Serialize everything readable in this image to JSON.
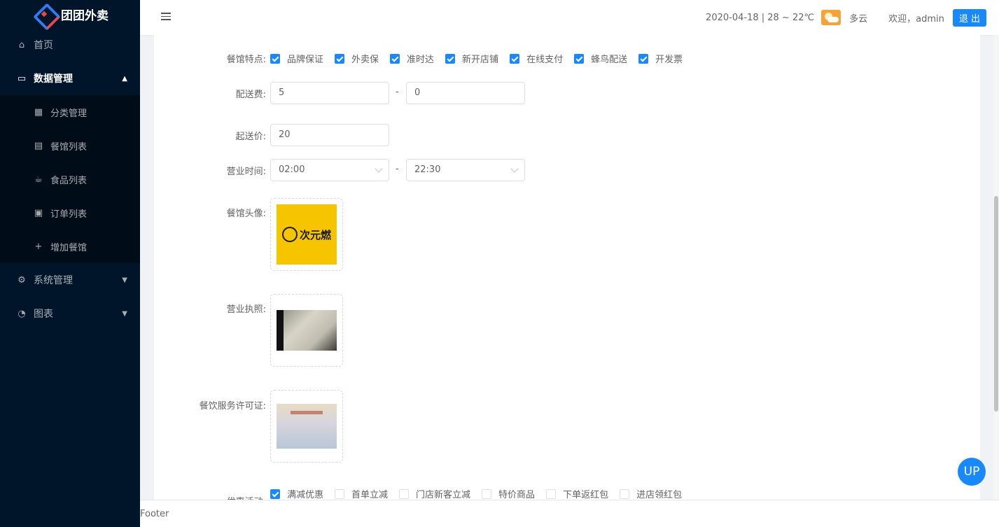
{
  "app": {
    "title": "团团外卖"
  },
  "sidebar": {
    "home": "首页",
    "data_mgmt": "数据管理",
    "sub": [
      "分类管理",
      "餐馆列表",
      "食品列表",
      "订单列表",
      "增加餐馆"
    ],
    "system": "系统管理",
    "charts": "图表"
  },
  "header": {
    "date_weather": "2020-04-18 | 28 ~ 22℃",
    "weather": "多云",
    "welcome": "欢迎，admin",
    "logout": "退 出"
  },
  "form": {
    "features_label": "餐馆特点:",
    "features": [
      "品牌保证",
      "外卖保",
      "准时达",
      "新开店铺",
      "在线支付",
      "蜂鸟配送",
      "开发票"
    ],
    "delivery_fee_label": "配送费:",
    "delivery_fee_min": "5",
    "delivery_fee_max": "0",
    "min_order_label": "起送价:",
    "min_order": "20",
    "hours_label": "营业时间:",
    "open_time": "02:00",
    "close_time": "22:30",
    "dash": "-",
    "avatar_label": "餐馆头像:",
    "avatar_text": "次元燃",
    "license_label": "营业执照:",
    "permit_label": "餐饮服务许可证:",
    "promo_label": "优惠活动:",
    "promos": [
      "满减优惠",
      "首单立减",
      "门店新客立减",
      "特价商品",
      "下单返红包",
      "进店领红包"
    ]
  },
  "footer": {
    "text": "Footer"
  },
  "up": "UP",
  "colors": {
    "sidebar_bg": "#001529",
    "accent": "#1989fa"
  }
}
